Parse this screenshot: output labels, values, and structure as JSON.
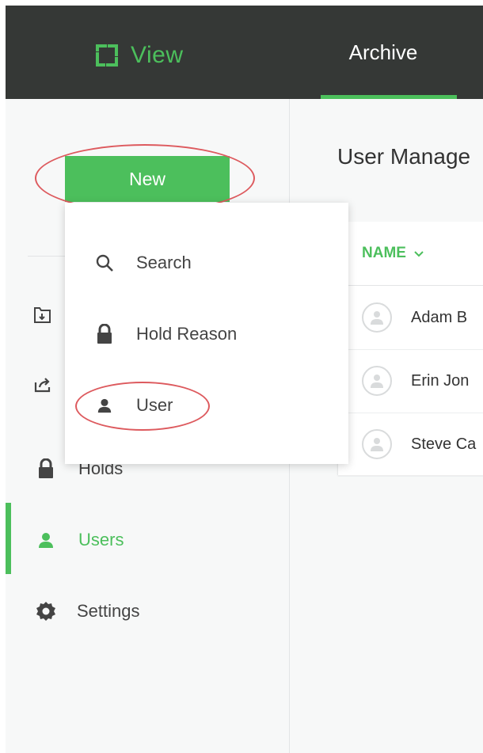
{
  "header": {
    "logo_text": "View",
    "nav_tab": "Archive",
    "accent_color": "#4cbf5c",
    "background_color": "#353836"
  },
  "sidebar": {
    "new_button_label": "New",
    "items": [
      {
        "label": "",
        "icon": "folder-icon"
      },
      {
        "label": "",
        "icon": "share-icon"
      },
      {
        "label": "Holds",
        "icon": "lock-icon"
      },
      {
        "label": "Users",
        "icon": "user-icon",
        "active": true
      },
      {
        "label": "Settings",
        "icon": "gear-icon"
      }
    ]
  },
  "dropdown": {
    "items": [
      {
        "label": "Search",
        "icon": "search-icon"
      },
      {
        "label": "Hold Reason",
        "icon": "lock-icon"
      },
      {
        "label": "User",
        "icon": "user-icon"
      }
    ]
  },
  "main": {
    "title": "User Manage",
    "table": {
      "column_header": "NAME",
      "rows": [
        {
          "name": "Adam B"
        },
        {
          "name": "Erin Jon"
        },
        {
          "name": "Steve Ca"
        }
      ]
    }
  },
  "annotations": {
    "highlight_color": "#dd5a5e"
  }
}
